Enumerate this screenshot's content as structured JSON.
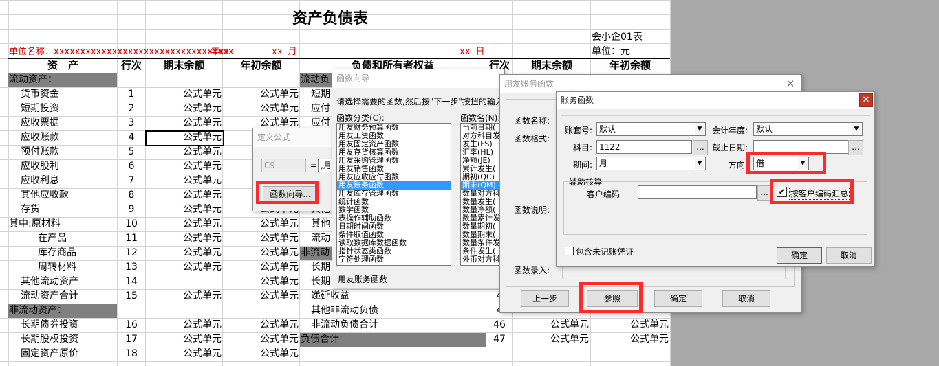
{
  "sheet": {
    "title": "资产负债表",
    "form_code": "会小企01表",
    "unit_label": "单位：元",
    "entity_line": "单位名称：xxxxxxxxxxxxxxxxxxxxxxxxxxxxxxxxxx",
    "year_label": "年",
    "year_value": "xx",
    "month_value": "xx 月",
    "day_value": "xx 日",
    "headers": {
      "asset": "资　产",
      "line_no": "行次",
      "end_balance": "期末余额",
      "begin_balance": "年初余额",
      "liab": "负债和所有者权益",
      "line_no2": "行次",
      "end_balance2": "期末余额",
      "begin_balance2": "年初余额"
    },
    "formula_cell": "公式单元",
    "left_rows": [
      {
        "label": "流动资产：",
        "no": "",
        "end": "",
        "begin": ""
      },
      {
        "label": "货币资金",
        "no": "1",
        "end": "公式单元",
        "begin": "公式单元"
      },
      {
        "label": "短期投资",
        "no": "2",
        "end": "公式单元",
        "begin": "公式单元"
      },
      {
        "label": "应收票据",
        "no": "3",
        "end": "公式单元",
        "begin": "公式单元"
      },
      {
        "label": "应收账款",
        "no": "4",
        "end": "公式单元",
        "begin": "公式单元"
      },
      {
        "label": "预付账款",
        "no": "5",
        "end": "公式单元",
        "begin": "公式单元"
      },
      {
        "label": "应收股利",
        "no": "6",
        "end": "公式单元",
        "begin": "公式单元"
      },
      {
        "label": "应收利息",
        "no": "7",
        "end": "公式单元",
        "begin": "公式单元"
      },
      {
        "label": "其他应收款",
        "no": "8",
        "end": "公式单元",
        "begin": "公式单元"
      },
      {
        "label": "存货",
        "no": "9",
        "end": "公式单元",
        "begin": "公式单元"
      },
      {
        "label": "其中:原材料",
        "no": "10",
        "end": "公式单元",
        "begin": "公式单元"
      },
      {
        "label": "在产品",
        "no": "11",
        "end": "公式单元",
        "begin": "公式单元"
      },
      {
        "label": "库存商品",
        "no": "12",
        "end": "公式单元",
        "begin": "公式单元"
      },
      {
        "label": "周转材料",
        "no": "13",
        "end": "公式单元",
        "begin": "公式单元"
      },
      {
        "label": "其他流动资产",
        "no": "14",
        "end": "",
        "begin": "公式单元"
      },
      {
        "label": "流动资产合计",
        "no": "15",
        "end": "公式单元",
        "begin": "公式单元"
      },
      {
        "label": "非流动资产：",
        "no": "",
        "end": "",
        "begin": ""
      },
      {
        "label": "长期债券投资",
        "no": "16",
        "end": "公式单元",
        "begin": "公式单元"
      },
      {
        "label": "长期股权投资",
        "no": "17",
        "end": "公式单元",
        "begin": "公式单元"
      },
      {
        "label": "固定资产原价",
        "no": "18",
        "end": "公式单元",
        "begin": "公式单元"
      }
    ],
    "right_rows": [
      {
        "label": "流动负",
        "no": "",
        "end": "",
        "begin": ""
      },
      {
        "label": "短期",
        "no": "",
        "end": "",
        "begin": ""
      },
      {
        "label": "应付",
        "no": "",
        "end": "",
        "begin": ""
      },
      {
        "label": "应付",
        "no": "",
        "end": "",
        "begin": ""
      },
      {
        "label": "",
        "no": "",
        "end": "",
        "begin": ""
      },
      {
        "label": "",
        "no": "",
        "end": "",
        "begin": ""
      },
      {
        "label": "",
        "no": "",
        "end": "",
        "begin": ""
      },
      {
        "label": "",
        "no": "",
        "end": "",
        "begin": ""
      },
      {
        "label": "",
        "no": "",
        "end": "",
        "begin": ""
      },
      {
        "label": "其他",
        "no": "",
        "end": "",
        "begin": ""
      },
      {
        "label": "其他",
        "no": "",
        "end": "",
        "begin": ""
      },
      {
        "label": "流动",
        "no": "",
        "end": "",
        "begin": ""
      },
      {
        "label": "非流动",
        "no": "",
        "end": "",
        "begin": ""
      },
      {
        "label": "长期",
        "no": "",
        "end": "",
        "begin": ""
      },
      {
        "label": "长期",
        "no": "",
        "end": "",
        "begin": ""
      },
      {
        "label": "递延收益",
        "no": "4",
        "end": "",
        "begin": ""
      },
      {
        "label": "其他非流动负债",
        "no": "4",
        "end": "",
        "begin": ""
      },
      {
        "label": "非流动负债合计",
        "no": "46",
        "end": "公式单元",
        "begin": "公式单元"
      },
      {
        "label": "负债合计",
        "no": "47",
        "end": "公式单元",
        "begin": "公式单元"
      }
    ]
  },
  "define_formula": {
    "title": "定义公式",
    "cell_ref": "C9",
    "equals": "=",
    "formula_value": ",月",
    "wizard_button": "函数向导..."
  },
  "func_wizard": {
    "title": "函数向导",
    "instruction": "请选择需要的函数,然后按\"下一步\"按扭的输入",
    "category_label": "函数分类(C):",
    "name_label": "函数名(N):",
    "categories": [
      "用友财务预算函数",
      "用友工资函数",
      "用友固定资产函数",
      "用友存货核算函数",
      "用友采购管理函数",
      "用友销售函数",
      "用友应收应付函数",
      "用友账务函数",
      "用友库存管理函数",
      "统计函数",
      "数学函数",
      "表操作辅助函数",
      "日期时间函数",
      "条件取值函数",
      "读取数据库数据函数",
      "指针状态类函数",
      "字符处理函数"
    ],
    "selected_category": "用友账务函数",
    "names": [
      "当前日期(",
      "对方科目发",
      "发生(FS)",
      "汇率(HL)",
      "净额(JE)",
      "累计发生(",
      "期初(QC)",
      "期末(QM)",
      "数量对方科",
      "数量发生(",
      "数量净额(",
      "数量累计发",
      "数量期初(",
      "数量期末(",
      "数量条件发",
      "条件发生(",
      "外币对方科"
    ],
    "selected_name": "期末(QM)",
    "description": "用友账务函数"
  },
  "yonyou_dialog": {
    "title": "用友账务函数",
    "func_name_label": "函数名称:",
    "func_format_label": "函数格式:",
    "func_desc_label": "函数说明:",
    "func_input_label": "函数录入:",
    "prev_button": "上一步",
    "ref_button": "参照",
    "ok_button": "确定",
    "cancel_button": "取消"
  },
  "account_func": {
    "title": "账务函数",
    "book_label": "账套号:",
    "book_value": "默认",
    "year_label": "会计年度:",
    "year_value": "默认",
    "subject_label": "科目:",
    "subject_value": "1122",
    "cutoff_label": "截止日期:",
    "cutoff_value": "",
    "period_label": "期间:",
    "period_value": "月",
    "direction_label": "方向:",
    "direction_value": "借",
    "aux_group_label": "辅助核算",
    "customer_code_label": "客户编码",
    "customer_code_value": "",
    "summary_checkbox_label": "按客户编码汇总",
    "include_unposted_label": "包含未记账凭证",
    "ok_button": "确定",
    "cancel_button": "取消",
    "browse": "..."
  }
}
